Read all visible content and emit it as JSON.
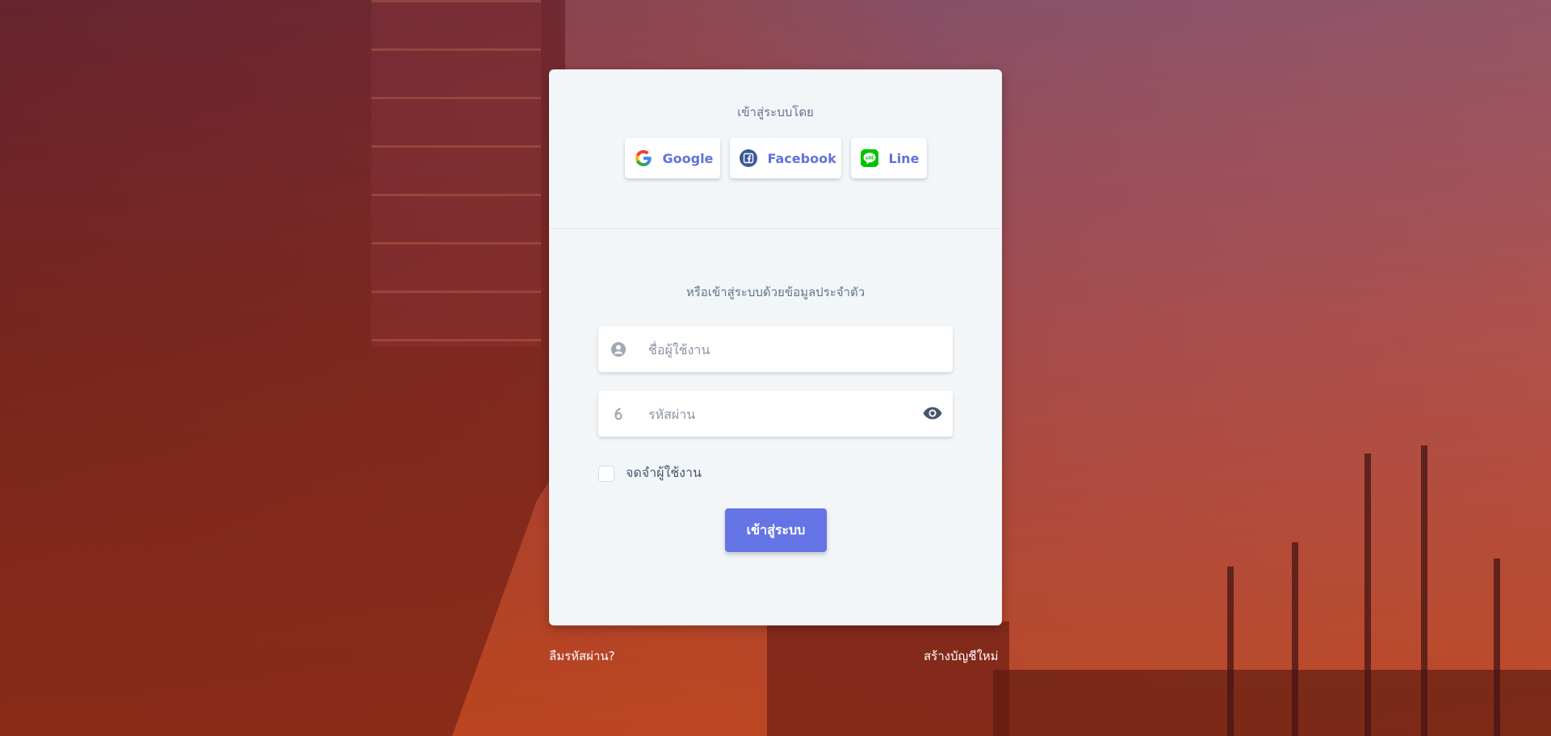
{
  "colors": {
    "accent": "#6474e5",
    "card_background": "#f3f6f9",
    "social_label": "#6272d8",
    "google_red": "#ea4335",
    "facebook_blue": "#3b5998",
    "line_green": "#00c300"
  },
  "social": {
    "heading": "เข้าสู่ระบบโดย",
    "buttons": [
      {
        "label": "Google",
        "icon": "google-icon"
      },
      {
        "label": "Facebook",
        "icon": "facebook-icon"
      },
      {
        "label": "Line",
        "icon": "line-icon"
      }
    ]
  },
  "form": {
    "heading": "หรือเข้าสู่ระบบด้วยข้อมูลประจำตัว",
    "username": {
      "placeholder": "ชื่อผู้ใช้งาน",
      "value": "",
      "icon": "user-icon"
    },
    "password": {
      "placeholder": "รหัสผ่าน",
      "value": "",
      "icon": "lock-icon",
      "toggle_icon": "eye-icon"
    },
    "remember_label": "จดจำผู้ใช้งาน",
    "remember_checked": false,
    "submit_label": "เข้าสู่ระบบ"
  },
  "footer": {
    "forgot_password": "ลืมรหัสผ่าน?",
    "create_account": "สร้างบัญชีใหม่"
  }
}
